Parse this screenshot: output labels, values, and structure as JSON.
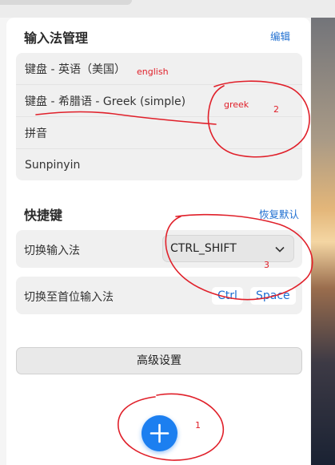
{
  "im_section": {
    "title": "输入法管理",
    "edit_link": "编辑",
    "items": [
      {
        "label": "键盘 - 英语（美国）"
      },
      {
        "label": "键盘 - 希腊语 - Greek (simple)"
      },
      {
        "label": "拼音"
      },
      {
        "label": "Sunpinyin"
      }
    ]
  },
  "shortcut_section": {
    "title": "快捷键",
    "reset_link": "恢复默认",
    "switch_label": "切换输入法",
    "switch_value": "CTRL_SHIFT",
    "first_label": "切换至首位输入法",
    "first_keys": [
      "Ctrl",
      "Space"
    ]
  },
  "advanced_button": "高级设置",
  "annotations": {
    "english": "english",
    "greek": "greek",
    "n1": "1",
    "n2": "2",
    "n3": "3"
  },
  "colors": {
    "accent": "#1f6fd1",
    "add_button": "#1c7ff0",
    "annotation": "#e0202a"
  },
  "icons": {
    "dropdown": "chevron-down-icon",
    "add": "plus-icon"
  }
}
